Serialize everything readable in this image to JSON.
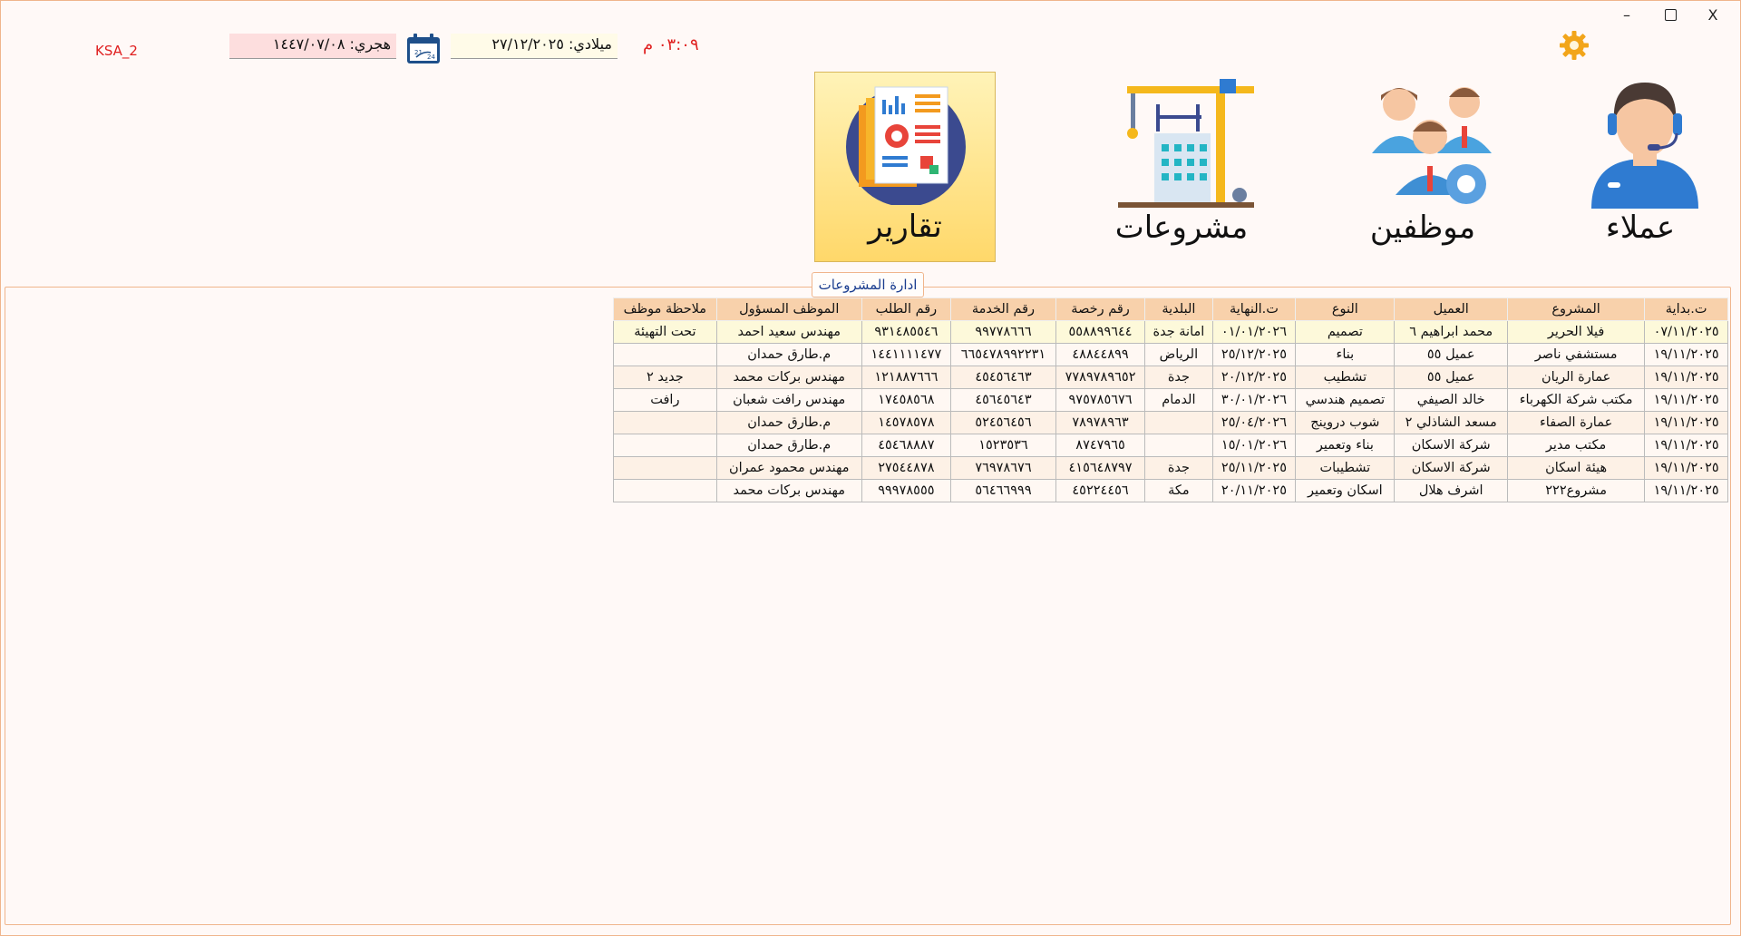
{
  "window": {
    "min_symbol": "–",
    "close_symbol": "X"
  },
  "topbar": {
    "instance": "KSA_2",
    "hijri": "هجري: ١٤٤٧/٠٧/٠٨",
    "gregorian": "ميلادي: ٢٧/١٢/٢٠٢٥",
    "time": "٠٣:٠٩ م",
    "settings_icon": "gear-icon",
    "calendar_icon": "calendar-icon",
    "accent_color": "#e02020"
  },
  "modules": {
    "reports": {
      "label": "تقارير",
      "icon": "reports-icon"
    },
    "projects": {
      "label": "مشروعات",
      "icon": "construction-icon"
    },
    "employees": {
      "label": "موظفين",
      "icon": "employees-icon"
    },
    "clients": {
      "label": "عملاء",
      "icon": "support-agent-icon"
    }
  },
  "panel": {
    "title": "ادارة المشروعات"
  },
  "table": {
    "headers": [
      "ت.بداية",
      "المشروع",
      "العميل",
      "النوع",
      "ت.النهاية",
      "البلدية",
      "رقم رخصة",
      "رقم الخدمة",
      "رقم الطلب",
      "الموظف المسؤول",
      "ملاحظة موظف"
    ],
    "rows": [
      [
        "٠٧/١١/٢٠٢٥",
        "فيلا الحرير",
        "محمد ابراهيم ٦",
        "تصميم",
        "٠١/٠١/٢٠٢٦",
        "امانة جدة",
        "٥٥٨٨٩٩٦٤٤",
        "٩٩٧٧٨٦٦٦",
        "٩٣١٤٨٥٥٤٦",
        "مهندس سعيد احمد",
        "تحت التهيئة"
      ],
      [
        "١٩/١١/٢٠٢٥",
        "مستشفي ناصر",
        "عميل ٥٥",
        "بناء",
        "٢٥/١٢/٢٠٢٥",
        "الرياض",
        "٤٨٨٤٤٨٩٩",
        "٦٦٥٤٧٨٩٩٢٢٣١",
        "١٤٤١١١١٤٧٧",
        "م.طارق حمدان",
        ""
      ],
      [
        "١٩/١١/٢٠٢٥",
        "عمارة الريان",
        "عميل ٥٥",
        "تشطيب",
        "٢٠/١٢/٢٠٢٥",
        "جدة",
        "٧٧٨٩٧٨٩٦٥٢",
        "٤٥٤٥٦٤٦٣",
        "١٢١٨٨٧٦٦٦",
        "مهندس بركات محمد",
        "جديد ٢"
      ],
      [
        "١٩/١١/٢٠٢٥",
        "مكتب شركة الكهرباء",
        "خالد الصيفي",
        "تصميم هندسي",
        "٣٠/٠١/٢٠٢٦",
        "الدمام",
        "٩٧٥٧٨٥٦٧٦",
        "٤٥٦٤٥٦٤٣",
        "١٧٤٥٨٥٦٨",
        "مهندس رافت شعبان",
        "رافت"
      ],
      [
        "١٩/١١/٢٠٢٥",
        "عمارة الصفاء",
        "مسعد الشاذلي ٢",
        "شوب دروينج",
        "٢٥/٠٤/٢٠٢٦",
        "",
        "٧٨٩٧٨٩٦٣",
        "٥٢٤٥٦٤٥٦",
        "١٤٥٧٨٥٧٨",
        "م.طارق حمدان",
        ""
      ],
      [
        "١٩/١١/٢٠٢٥",
        "مكتب مدير",
        "شركة الاسكان",
        "بناء وتعمير",
        "١٥/٠١/٢٠٢٦",
        "",
        "٨٧٤٧٩٦٥",
        "١٥٢٣٥٣٦",
        "٤٥٤٦٨٨٨٧",
        "م.طارق حمدان",
        ""
      ],
      [
        "١٩/١١/٢٠٢٥",
        "هيئة اسكان",
        "شركة الاسكان",
        "تشطيبات",
        "٢٥/١١/٢٠٢٥",
        "جدة",
        "٤١٥٦٤٨٧٩٧",
        "٧٦٩٧٨٦٧٦",
        "٢٧٥٤٤٨٧٨",
        "مهندس محمود عمران",
        ""
      ],
      [
        "١٩/١١/٢٠٢٥",
        "مشروع٢٢٢",
        "اشرف هلال",
        "اسكان وتعمير",
        "٢٠/١١/٢٠٢٥",
        "مكة",
        "٤٥٢٢٤٤٥٦",
        "٥٦٤٦٦٩٩٩",
        "٩٩٩٧٨٥٥٥",
        "مهندس بركات محمد",
        ""
      ]
    ]
  }
}
